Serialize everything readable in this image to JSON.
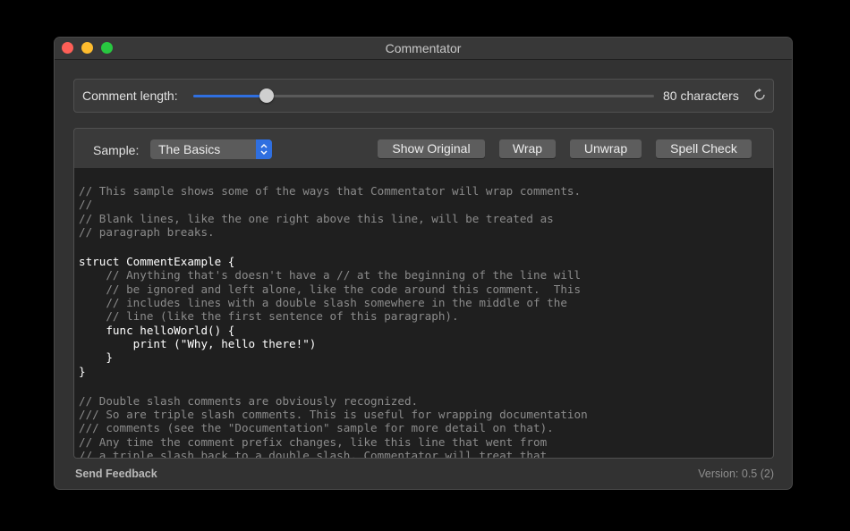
{
  "window": {
    "title": "Commentator"
  },
  "comment_length": {
    "label": "Comment length:",
    "slider_fraction": 0.16,
    "value_text": "80 characters",
    "reset_icon": "reset-arrow-icon"
  },
  "sample": {
    "label": "Sample:",
    "selected": "The Basics"
  },
  "buttons": {
    "show_original": "Show Original",
    "wrap": "Wrap",
    "unwrap": "Unwrap",
    "spell_check": "Spell Check"
  },
  "code_lines": [
    {
      "text": "// This sample shows some of the ways that Commentator will wrap comments.",
      "kind": "comment"
    },
    {
      "text": "//",
      "kind": "comment"
    },
    {
      "text": "// Blank lines, like the one right above this line, will be treated as",
      "kind": "comment"
    },
    {
      "text": "// paragraph breaks.",
      "kind": "comment"
    },
    {
      "text": "",
      "kind": "blank"
    },
    {
      "text": "struct CommentExample {",
      "kind": "code"
    },
    {
      "text": "    // Anything that's doesn't have a // at the beginning of the line will",
      "kind": "comment"
    },
    {
      "text": "    // be ignored and left alone, like the code around this comment.  This",
      "kind": "comment"
    },
    {
      "text": "    // includes lines with a double slash somewhere in the middle of the",
      "kind": "comment"
    },
    {
      "text": "    // line (like the first sentence of this paragraph).",
      "kind": "comment"
    },
    {
      "text": "    func helloWorld() {",
      "kind": "code"
    },
    {
      "text": "        print (\"Why, hello there!\")",
      "kind": "code"
    },
    {
      "text": "    }",
      "kind": "code"
    },
    {
      "text": "}",
      "kind": "code"
    },
    {
      "text": "",
      "kind": "blank"
    },
    {
      "text": "// Double slash comments are obviously recognized.",
      "kind": "comment"
    },
    {
      "text": "/// So are triple slash comments. This is useful for wrapping documentation",
      "kind": "comment"
    },
    {
      "text": "/// comments (see the \"Documentation\" sample for more detail on that).",
      "kind": "comment"
    },
    {
      "text": "// Any time the comment prefix changes, like this line that went from",
      "kind": "comment"
    },
    {
      "text": "// a triple slash back to a double slash, Commentator will treat that",
      "kind": "comment"
    }
  ],
  "footer": {
    "feedback": "Send Feedback",
    "version": "Version: 0.5 (2)"
  },
  "colors": {
    "accent": "#2f6fe0",
    "close": "#fe5f57",
    "minimize": "#febc2e",
    "zoom": "#28c840"
  }
}
